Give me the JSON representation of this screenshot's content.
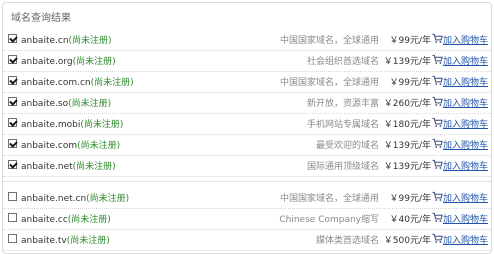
{
  "section_title": "域名查询结果",
  "cart_label": "加入购物车",
  "rows": [
    {
      "domain": "anbaite.cn",
      "status": "(尚未注册)",
      "desc": "中国国家域名，全球通用",
      "price": "￥99元/年",
      "checked": true
    },
    {
      "domain": "anbaite.org",
      "status": "(尚未注册)",
      "desc": "社会组织首选域名",
      "price": "￥139元/年",
      "checked": true
    },
    {
      "domain": "anbaite.com.cn",
      "status": "(尚未注册)",
      "desc": "中国国家域名，全球通用",
      "price": "￥99元/年",
      "checked": true
    },
    {
      "domain": "anbaite.so",
      "status": "(尚未注册)",
      "desc": "新开放，资源丰富",
      "price": "￥260元/年",
      "checked": true
    },
    {
      "domain": "anbaite.mobi",
      "status": "(尚未注册)",
      "desc": "手机网站专属域名",
      "price": "￥180元/年",
      "checked": true
    },
    {
      "domain": "anbaite.com",
      "status": "(尚未注册)",
      "desc": "最受欢迎的域名",
      "price": "￥139元/年",
      "checked": true
    },
    {
      "domain": "anbaite.net",
      "status": "(尚未注册)",
      "desc": "国际通用顶级域名",
      "price": "￥139元/年",
      "checked": true
    },
    {
      "domain": "anbaite.net.cn",
      "status": "(尚未注册)",
      "desc": "中国国家域名，全球通用",
      "price": "￥99元/年",
      "checked": false
    },
    {
      "domain": "anbaite.cc",
      "status": "(尚未注册)",
      "desc": "Chinese Company缩写",
      "price": "￥40元/年",
      "checked": false
    },
    {
      "domain": "anbaite.tv",
      "status": "(尚未注册)",
      "desc": "媒体类首选域名",
      "price": "￥500元/年",
      "checked": false
    }
  ]
}
